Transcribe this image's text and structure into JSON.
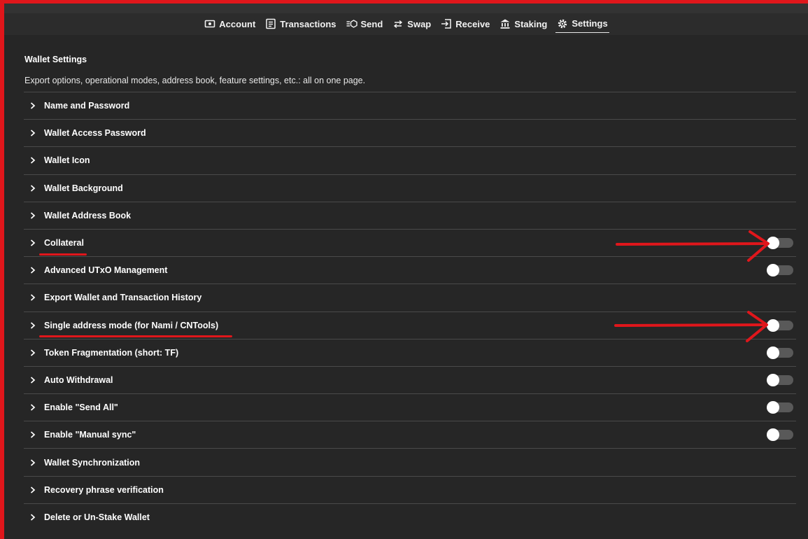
{
  "nav": {
    "tabs": [
      {
        "label": "Account",
        "icon": "account-icon"
      },
      {
        "label": "Transactions",
        "icon": "transactions-icon"
      },
      {
        "label": "Send",
        "icon": "send-icon"
      },
      {
        "label": "Swap",
        "icon": "swap-icon"
      },
      {
        "label": "Receive",
        "icon": "receive-icon"
      },
      {
        "label": "Staking",
        "icon": "staking-icon"
      },
      {
        "label": "Settings",
        "icon": "gear-icon"
      }
    ],
    "active_tab": "Settings"
  },
  "settings": {
    "title": "Wallet Settings",
    "description": "Export options, operational modes, address book, feature settings, etc.: all on one page.",
    "items": [
      {
        "label": "Name and Password",
        "toggle": false
      },
      {
        "label": "Wallet Access Password",
        "toggle": false
      },
      {
        "label": "Wallet Icon",
        "toggle": false
      },
      {
        "label": "Wallet Background",
        "toggle": false
      },
      {
        "label": "Wallet Address Book",
        "toggle": false
      },
      {
        "label": "Collateral",
        "toggle": true,
        "enabled": false
      },
      {
        "label": "Advanced UTxO Management",
        "toggle": true,
        "enabled": false
      },
      {
        "label": "Export Wallet and Transaction History",
        "toggle": false
      },
      {
        "label": "Single address mode (for Nami / CNTools)",
        "toggle": true,
        "enabled": false
      },
      {
        "label": "Token Fragmentation (short: TF)",
        "toggle": true,
        "enabled": false
      },
      {
        "label": "Auto Withdrawal",
        "toggle": true,
        "enabled": false
      },
      {
        "label": "Enable \"Send All\"",
        "toggle": true,
        "enabled": false
      },
      {
        "label": "Enable \"Manual sync\"",
        "toggle": true,
        "enabled": false
      },
      {
        "label": "Wallet Synchronization",
        "toggle": false
      },
      {
        "label": "Recovery phrase verification",
        "toggle": false
      },
      {
        "label": "Delete or Un-Stake Wallet",
        "toggle": false
      }
    ]
  },
  "colors": {
    "background": "#262626",
    "annotation_red": "#e0161b",
    "toggle_track": "#595959",
    "divider": "#4a4a4a"
  }
}
